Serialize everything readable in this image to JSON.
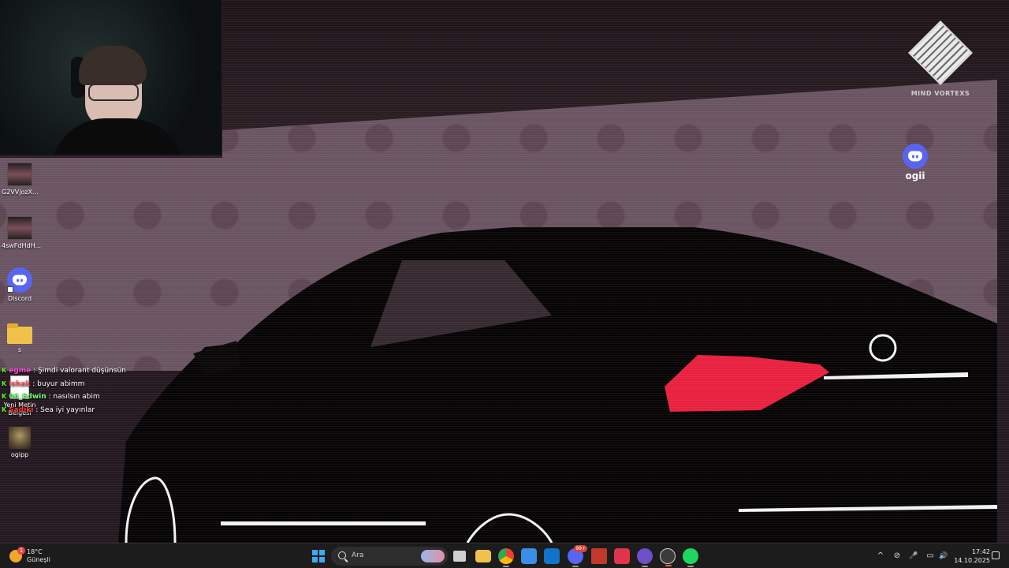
{
  "desktop": {
    "icons": [
      {
        "label": "G2VVjozX...",
        "icon": "video-thumbnail-icon"
      },
      {
        "label": "4swFdHdH...",
        "icon": "video-thumbnail-icon"
      },
      {
        "label": "Discord",
        "icon": "discord-icon"
      },
      {
        "label": "s",
        "icon": "folder-icon"
      },
      {
        "label": "Yeni Metin Belgesi",
        "icon": "text-document-icon"
      },
      {
        "label": "ogipp",
        "icon": "image-file-icon"
      }
    ]
  },
  "chat": {
    "messages": [
      {
        "badge": "K",
        "user": "egme",
        "user_color": "#ff4fd8",
        "sep": ":",
        "text": "Şimdi valorant düşünsün"
      },
      {
        "badge": "K",
        "user": "Ishak",
        "user_color": "#ff5a5a",
        "sep": ":",
        "text": "buyur abimm"
      },
      {
        "badge": "K",
        "user": "06_Edwin",
        "user_color": "#6fff6f",
        "sep": ":",
        "text": "nasılsın abim"
      },
      {
        "badge": "K",
        "user": "Sadiki",
        "user_color": "#ff3a3a",
        "sep": ":",
        "text": "Sea iyi yayınlar"
      }
    ]
  },
  "overlay": {
    "brand_text": "MIND VORTEXS",
    "discord_name": "ogii"
  },
  "taskbar": {
    "weather_temp": "18°C",
    "weather_desc": "Güneşli",
    "weather_badge": "1",
    "search_placeholder": "Ara",
    "apps": [
      {
        "name": "task-view-icon",
        "color": "#cfcfcf",
        "badge": ""
      },
      {
        "name": "file-explorer-icon",
        "color": "#f1c24b",
        "badge": ""
      },
      {
        "name": "chrome-icon",
        "color": "#4285f4",
        "badge": ""
      },
      {
        "name": "store-icon",
        "color": "#3a8ee6",
        "badge": ""
      },
      {
        "name": "outlook-icon",
        "color": "#1173c9",
        "badge": ""
      },
      {
        "name": "discord-icon",
        "color": "#5865F2",
        "badge": "99+"
      },
      {
        "name": "wincc-icon",
        "color": "#c0392b",
        "badge": ""
      },
      {
        "name": "valorant-icon",
        "color": "#e0344a",
        "badge": ""
      },
      {
        "name": "obs-studio-icon",
        "color": "#6e4fc9",
        "badge": ""
      },
      {
        "name": "recording-icon",
        "color": "#3b3b3b",
        "badge": ""
      },
      {
        "name": "spotify-icon",
        "color": "#1ed760",
        "badge": ""
      }
    ],
    "tray": [
      "^",
      "⊘",
      "🎤",
      "▭",
      "🔊"
    ],
    "time": "17:42",
    "date": "14.10.2025"
  },
  "colors": {
    "accent_red": "#e8213f",
    "discord_blurple": "#5865F2",
    "taskbar_bg": "#1c1c1c"
  }
}
